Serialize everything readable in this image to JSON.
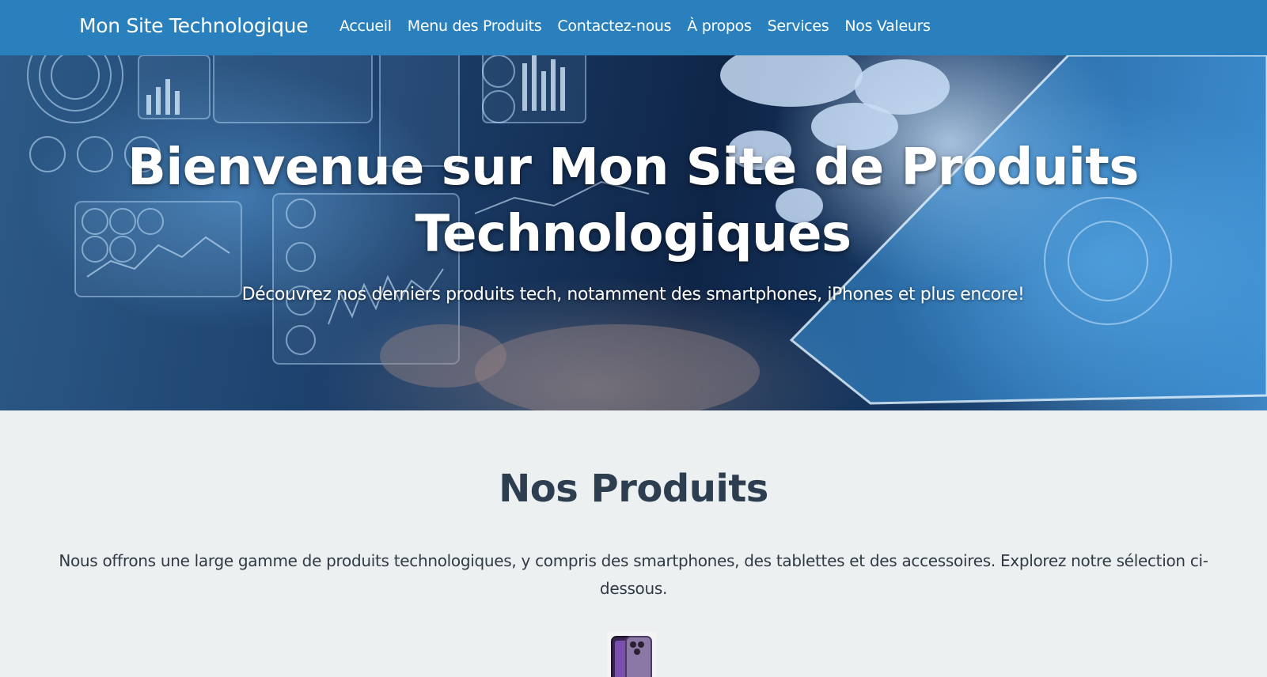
{
  "header": {
    "brand": "Mon Site Technologique",
    "nav": [
      {
        "label": "Accueil"
      },
      {
        "label": "Menu des Produits"
      },
      {
        "label": "Contactez-nous"
      },
      {
        "label": "À propos"
      },
      {
        "label": "Services"
      },
      {
        "label": "Nos Valeurs"
      }
    ],
    "background_color": "#2a80bd"
  },
  "hero": {
    "title": "Bienvenue sur Mon Site de Produits Technologiques",
    "subtitle": "Découvrez nos derniers produits tech, notamment des smartphones, iPhones et plus encore!"
  },
  "products": {
    "title": "Nos Produits",
    "description": "Nous offrons une large gamme de produits technologiques, y compris des smartphones, des tablettes et des accessoires. Explorez notre sélection ci-dessous.",
    "items": [
      {
        "image_icon": "smartphone-icon"
      }
    ]
  },
  "colors": {
    "page_background": "#edf0f1",
    "heading": "#2c3e50"
  }
}
